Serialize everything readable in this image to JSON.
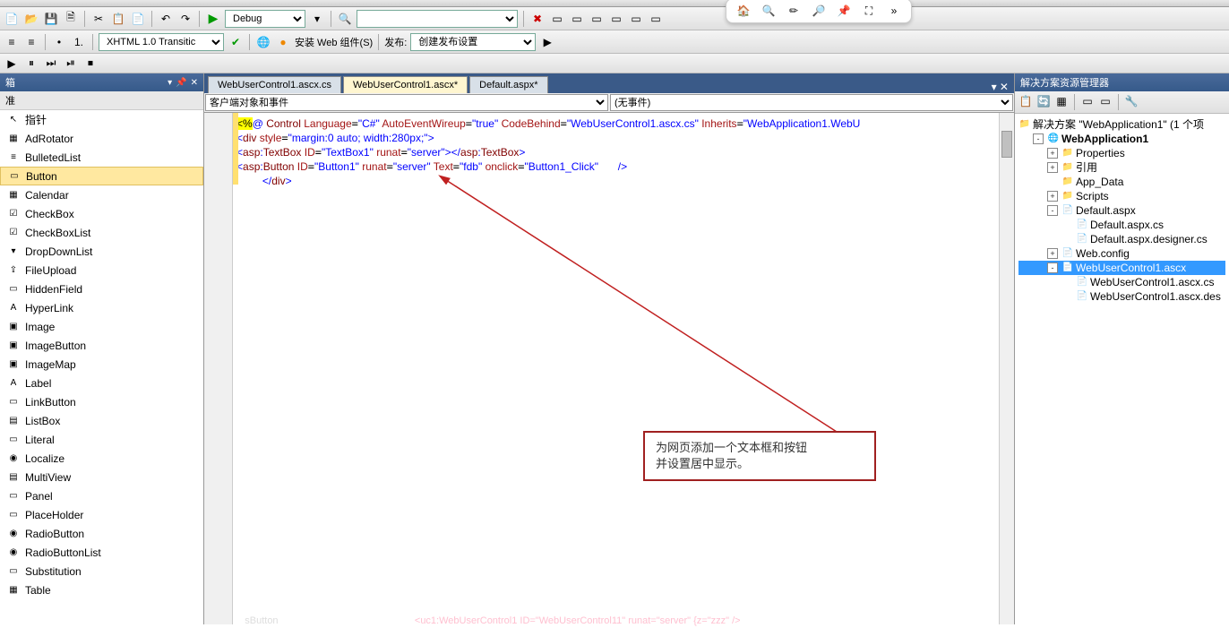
{
  "toolbars": {
    "config_combo": "Debug",
    "doctype_combo": "XHTML 1.0 Transitic",
    "install_btn": "安装 Web 组件(S)",
    "publish_label": "发布:",
    "publish_combo": "创建发布设置"
  },
  "toolbox": {
    "header": "箱",
    "category": "准",
    "items": [
      {
        "icon": "↖",
        "label": "指针"
      },
      {
        "icon": "▦",
        "label": "AdRotator"
      },
      {
        "icon": "≡",
        "label": "BulletedList"
      },
      {
        "icon": "▭",
        "label": "Button",
        "selected": true
      },
      {
        "icon": "▦",
        "label": "Calendar"
      },
      {
        "icon": "☑",
        "label": "CheckBox"
      },
      {
        "icon": "☑",
        "label": "CheckBoxList"
      },
      {
        "icon": "▾",
        "label": "DropDownList"
      },
      {
        "icon": "⇪",
        "label": "FileUpload"
      },
      {
        "icon": "▭",
        "label": "HiddenField"
      },
      {
        "icon": "A",
        "label": "HyperLink"
      },
      {
        "icon": "▣",
        "label": "Image"
      },
      {
        "icon": "▣",
        "label": "ImageButton"
      },
      {
        "icon": "▣",
        "label": "ImageMap"
      },
      {
        "icon": "A",
        "label": "Label"
      },
      {
        "icon": "▭",
        "label": "LinkButton"
      },
      {
        "icon": "▤",
        "label": "ListBox"
      },
      {
        "icon": "▭",
        "label": "Literal"
      },
      {
        "icon": "◉",
        "label": "Localize"
      },
      {
        "icon": "▤",
        "label": "MultiView"
      },
      {
        "icon": "▭",
        "label": "Panel"
      },
      {
        "icon": "▭",
        "label": "PlaceHolder"
      },
      {
        "icon": "◉",
        "label": "RadioButton"
      },
      {
        "icon": "◉",
        "label": "RadioButtonList"
      },
      {
        "icon": "▭",
        "label": "Substitution"
      },
      {
        "icon": "▦",
        "label": "Table"
      }
    ]
  },
  "tabs": [
    {
      "label": "WebUserControl1.ascx.cs",
      "active": false
    },
    {
      "label": "WebUserControl1.ascx*",
      "active": true
    },
    {
      "label": "Default.aspx*",
      "active": false
    }
  ],
  "dropdown1": "客户端对象和事件",
  "dropdown2": "(无事件)",
  "code": {
    "line1_parts": [
      "<%@",
      " Control",
      " Language",
      "=",
      "\"C#\"",
      " AutoEventWireup",
      "=",
      "\"true\"",
      " CodeBehind",
      "=",
      "\"WebUserControl1.ascx.cs\"",
      " Inherits",
      "=",
      "\"WebApplication1.WebU"
    ],
    "line2": "<div style=\"margin:0 auto; width:280px;\">",
    "line3": "<asp:TextBox ID=\"TextBox1\" runat=\"server\"></asp:TextBox>",
    "line4": "<asp:Button ID=\"Button1\" runat=\"server\" Text=\"fdb\" onclick=\"Button1_Click\"   />",
    "line5": "</div>"
  },
  "annotation": {
    "line1": "为网页添加一个文本框和按钮",
    "line2": "并设置居中显示。"
  },
  "solution": {
    "header": "解决方案资源管理器",
    "root": "解决方案 \"WebApplication1\" (1 个项",
    "project": "WebApplication1",
    "nodes": {
      "properties": "Properties",
      "references": "引用",
      "appdata": "App_Data",
      "scripts": "Scripts",
      "default_aspx": "Default.aspx",
      "default_cs": "Default.aspx.cs",
      "default_des": "Default.aspx.designer.cs",
      "webconfig": "Web.config",
      "wuc": "WebUserControl1.ascx",
      "wuc_cs": "WebUserControl1.ascx.cs",
      "wuc_des": "WebUserControl1.ascx.des"
    }
  },
  "status_line": "<uc1:WebUserControl1 ID=\"WebUserControl11\" runat=\"server\" {z=\"zzz\" />",
  "status_preview": "sButton"
}
